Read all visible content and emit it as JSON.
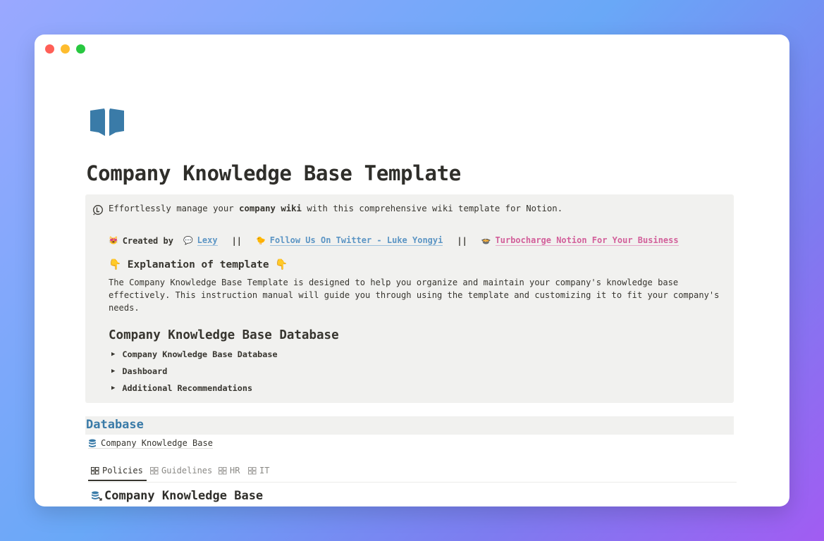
{
  "page": {
    "title": "Company Knowledge Base Template",
    "icon": "open-book-icon",
    "accent": "#3a7ba8"
  },
  "callout": {
    "icon": "info-timer-icon",
    "intro_prefix": "Effortlessly manage your ",
    "intro_bold": "company wiki",
    "intro_suffix": " with this comprehensive wiki template for Notion.",
    "credits": {
      "created_emoji": "😻",
      "created_label": "Created by",
      "lexy_emoji": "💬",
      "lexy_link": "Lexy",
      "sep": "||",
      "twitter_emoji": "🐤",
      "twitter_link": "Follow Us On Twitter - Luke Yongyi",
      "business_emoji": "🍲",
      "business_link": "Turbocharge Notion For Your Business"
    },
    "explanation_heading": "👇 Explanation of template 👇",
    "explanation_text": "The Company Knowledge Base Template is designed to help you organize and maintain your company's knowledge base effectively. This instruction manual will guide you through using the template and customizing it to fit your company's needs.",
    "db_heading": "Company Knowledge Base Database",
    "toggles": [
      "Company Knowledge Base Database",
      "Dashboard",
      "Additional Recommendations"
    ]
  },
  "database": {
    "section_title": "Database",
    "link_label": "Company Knowledge Base",
    "tabs": [
      "Policies",
      "Guidelines",
      "HR",
      "IT"
    ],
    "active_tab": "Policies",
    "view_title": "Company Knowledge Base"
  }
}
